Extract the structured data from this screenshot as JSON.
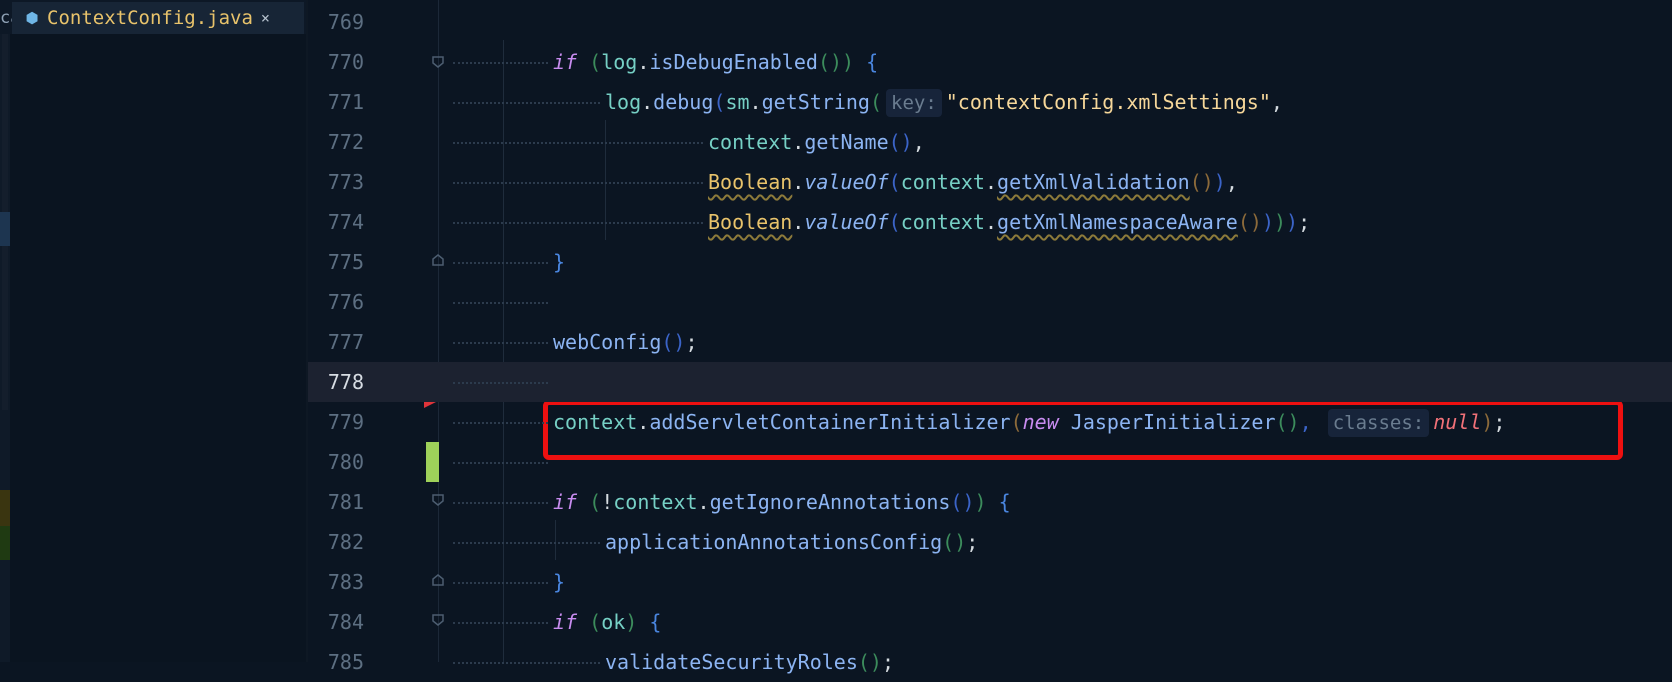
{
  "tab": {
    "partial_label": "ca",
    "filename": "ContextConfig.java",
    "close": "×"
  },
  "lines": [
    {
      "num": "769"
    },
    {
      "num": "770",
      "tokens": [
        {
          "t": "if",
          "c": "kw"
        },
        {
          "t": " (",
          "c": "p1"
        },
        {
          "t": "log",
          "c": "sm"
        },
        {
          "t": ".",
          "c": "semi"
        },
        {
          "t": "isDebugEnabled",
          "c": "meth"
        },
        {
          "t": "()",
          "c": "p1"
        },
        {
          "t": ") ",
          "c": "p1"
        },
        {
          "t": "{",
          "c": "brace"
        }
      ]
    },
    {
      "num": "771",
      "tokens": [
        {
          "t": "log",
          "c": "sm"
        },
        {
          "t": ".",
          "c": "semi"
        },
        {
          "t": "debug",
          "c": "meth"
        },
        {
          "t": "(",
          "c": "p2"
        },
        {
          "t": "sm",
          "c": "sm"
        },
        {
          "t": ".",
          "c": "semi"
        },
        {
          "t": "getString",
          "c": "meth"
        },
        {
          "t": "(",
          "c": "p1"
        },
        {
          "t": "key:",
          "c": "hint"
        },
        {
          "t": "\"contextConfig.xmlSettings\"",
          "c": "str"
        },
        {
          "t": ",",
          "c": "semi"
        }
      ]
    },
    {
      "num": "772",
      "tokens": [
        {
          "t": "context",
          "c": "sm"
        },
        {
          "t": ".",
          "c": "semi"
        },
        {
          "t": "getName",
          "c": "meth"
        },
        {
          "t": "()",
          "c": "p2"
        },
        {
          "t": ",",
          "c": "semi"
        }
      ]
    },
    {
      "num": "773",
      "tokens": [
        {
          "t": "Boolean",
          "c": "cls uline"
        },
        {
          "t": ".",
          "c": "semi"
        },
        {
          "t": "valueOf",
          "c": "ital"
        },
        {
          "t": "(",
          "c": "p2"
        },
        {
          "t": "context",
          "c": "sm"
        },
        {
          "t": ".",
          "c": "semi"
        },
        {
          "t": "getXmlValidation",
          "c": "meth uline"
        },
        {
          "t": "()",
          "c": "p3"
        },
        {
          "t": ")",
          "c": "p2"
        },
        {
          "t": ",",
          "c": "semi"
        }
      ]
    },
    {
      "num": "774",
      "tokens": [
        {
          "t": "Boolean",
          "c": "cls uline"
        },
        {
          "t": ".",
          "c": "semi"
        },
        {
          "t": "valueOf",
          "c": "ital"
        },
        {
          "t": "(",
          "c": "p2"
        },
        {
          "t": "context",
          "c": "sm"
        },
        {
          "t": ".",
          "c": "semi"
        },
        {
          "t": "getXmlNamespaceAware",
          "c": "meth uline"
        },
        {
          "t": "()",
          "c": "p3"
        },
        {
          "t": ")",
          "c": "p2"
        },
        {
          "t": ")",
          "c": "p1"
        },
        {
          "t": ")",
          "c": "p2"
        },
        {
          "t": ";",
          "c": "semi"
        }
      ]
    },
    {
      "num": "775",
      "tokens": [
        {
          "t": "}",
          "c": "brace"
        }
      ]
    },
    {
      "num": "776"
    },
    {
      "num": "777",
      "tokens": [
        {
          "t": "webConfig",
          "c": "meth"
        },
        {
          "t": "()",
          "c": "p2"
        },
        {
          "t": ";",
          "c": "semi"
        }
      ]
    },
    {
      "num": "778"
    },
    {
      "num": "779",
      "tokens": [
        {
          "t": "context",
          "c": "sm"
        },
        {
          "t": ".",
          "c": "semi"
        },
        {
          "t": "addServletContainerInitializer",
          "c": "meth"
        },
        {
          "t": "(",
          "c": "p3"
        },
        {
          "t": "new",
          "c": "kw"
        },
        {
          "t": " ",
          "c": "semi"
        },
        {
          "t": "JasperInitializer",
          "c": "meth"
        },
        {
          "t": "()",
          "c": "p1"
        },
        {
          "t": ", ",
          "c": "p2"
        },
        {
          "t": "classes:",
          "c": "hint"
        },
        {
          "t": "null",
          "c": "nullkw"
        },
        {
          "t": ")",
          "c": "p3"
        },
        {
          "t": ";",
          "c": "semi"
        }
      ]
    },
    {
      "num": "780"
    },
    {
      "num": "781",
      "tokens": [
        {
          "t": "if",
          "c": "kw"
        },
        {
          "t": " (",
          "c": "p1"
        },
        {
          "t": "!",
          "c": "semi"
        },
        {
          "t": "context",
          "c": "sm"
        },
        {
          "t": ".",
          "c": "semi"
        },
        {
          "t": "getIgnoreAnnotations",
          "c": "meth"
        },
        {
          "t": "()",
          "c": "p2"
        },
        {
          "t": ") ",
          "c": "p1"
        },
        {
          "t": "{",
          "c": "brace"
        }
      ]
    },
    {
      "num": "782",
      "tokens": [
        {
          "t": "applicationAnnotationsConfig",
          "c": "meth"
        },
        {
          "t": "()",
          "c": "p1"
        },
        {
          "t": ";",
          "c": "semi"
        }
      ]
    },
    {
      "num": "783",
      "tokens": [
        {
          "t": "}",
          "c": "brace"
        }
      ]
    },
    {
      "num": "784",
      "tokens": [
        {
          "t": "if",
          "c": "kw"
        },
        {
          "t": " (",
          "c": "p1"
        },
        {
          "t": "ok",
          "c": "sm"
        },
        {
          "t": ") ",
          "c": "p1"
        },
        {
          "t": "{",
          "c": "brace"
        }
      ]
    },
    {
      "num": "785",
      "tokens": [
        {
          "t": "validateSecurityRoles",
          "c": "meth"
        },
        {
          "t": "()",
          "c": "p1"
        },
        {
          "t": ";",
          "c": "semi"
        }
      ]
    }
  ],
  "current_line": "778",
  "colors": {
    "background": "#0b1522",
    "highlight_box": "#ee1010",
    "current_line": "#1c2230"
  }
}
